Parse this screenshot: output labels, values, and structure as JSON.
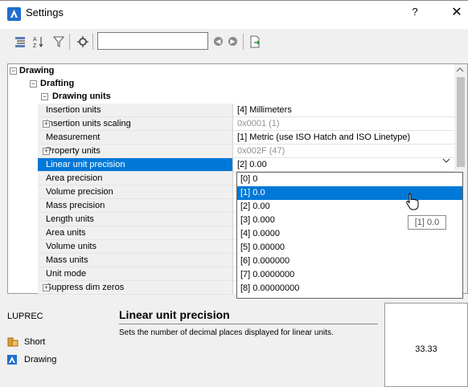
{
  "window": {
    "title": "Settings",
    "help": "?",
    "close": "✕"
  },
  "toolbar": {
    "search_value": "",
    "prev": "◀",
    "next": "▶"
  },
  "tree": {
    "root": "Drawing",
    "group": "Drafting",
    "section": "Drawing units",
    "rows": [
      {
        "name": "Insertion units",
        "value": "[4] Millimeters"
      },
      {
        "name": "Insertion units scaling",
        "value": "0x0001 (1)"
      },
      {
        "name": "Measurement",
        "value": "[1] Metric (use ISO Hatch and ISO Linetype)"
      },
      {
        "name": "Property units",
        "value": "0x002F (47)"
      },
      {
        "name": "Linear unit precision",
        "value": "[2] 0.00"
      },
      {
        "name": "Area precision",
        "value": ""
      },
      {
        "name": "Volume precision",
        "value": ""
      },
      {
        "name": "Mass precision",
        "value": ""
      },
      {
        "name": "Length units",
        "value": ""
      },
      {
        "name": "Area units",
        "value": ""
      },
      {
        "name": "Volume units",
        "value": ""
      },
      {
        "name": "Mass units",
        "value": ""
      },
      {
        "name": "Unit mode",
        "value": ""
      },
      {
        "name": "Suppress dim zeros",
        "value": ""
      }
    ]
  },
  "dropdown": {
    "options": [
      "[0] 0",
      "[1] 0.0",
      "[2] 0.00",
      "[3] 0.000",
      "[4] 0.0000",
      "[5] 0.00000",
      "[6] 0.000000",
      "[7] 0.0000000",
      "[8] 0.00000000"
    ],
    "highlighted_index": 1,
    "tooltip": "[1] 0.0"
  },
  "details": {
    "command": "LUPREC",
    "title": "Linear unit precision",
    "description": "Sets the number of decimal places displayed for linear units.",
    "short_label": "Short",
    "drawing_label": "Drawing",
    "preview_value": "33.33"
  },
  "colors": {
    "accent": "#0078d7",
    "brand": "#1e6fd0"
  }
}
